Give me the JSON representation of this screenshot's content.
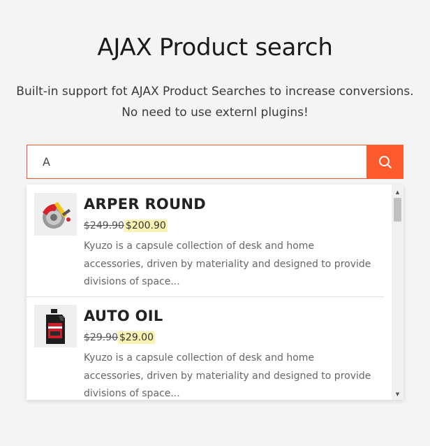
{
  "header": {
    "title": "AJAX Product search",
    "subtitle_line1": "Built-in support fot AJAX Product Searches to increase conversions.",
    "subtitle_line2": "No need to use externl plugins!"
  },
  "search": {
    "value": "A",
    "accent_color": "#fd5b2e"
  },
  "results": [
    {
      "name": "ARPER ROUND",
      "old_price": "$249.90",
      "new_price": "$200.90",
      "description": "Kyuzo is a capsule collection of desk and home accessories, driven by materiality and designed to provide divisions of space...",
      "thumb_icon": "brake-disc-icon"
    },
    {
      "name": "AUTO OIL",
      "old_price": "$29.90",
      "new_price": "$29.00",
      "description": "Kyuzo is a capsule collection of desk and home accessories, driven by materiality and designed to provide divisions of space...",
      "thumb_icon": "oil-can-icon"
    }
  ],
  "scrollbar": {
    "position": 0.0
  }
}
